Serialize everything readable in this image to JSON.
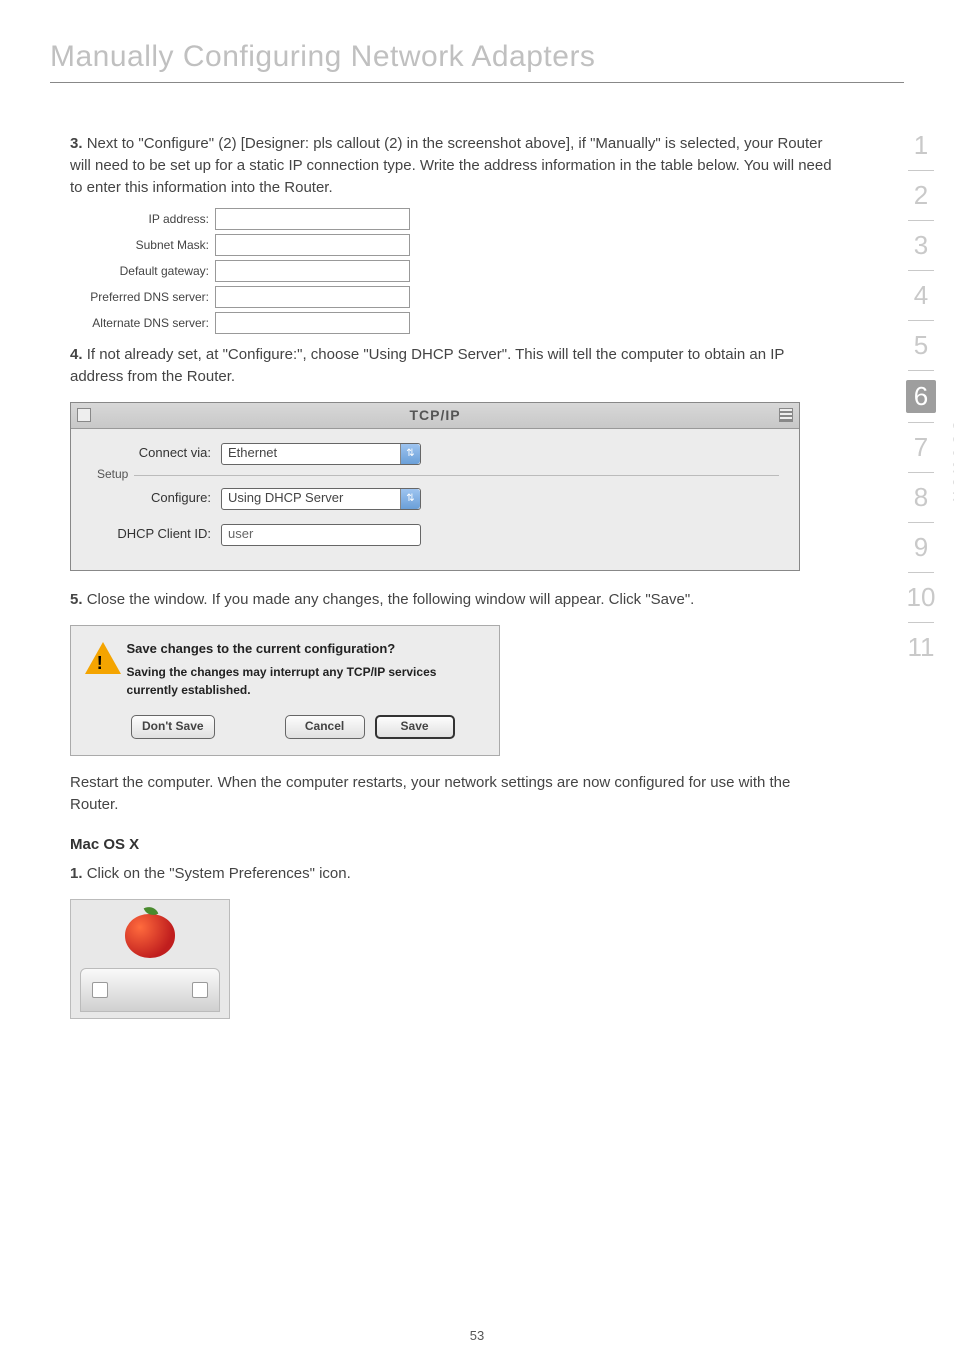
{
  "title": "Manually Configuring Network Adapters",
  "steps": {
    "s3": {
      "num": "3.",
      "text": "Next to \"Configure\" (2) [Designer: pls callout (2) in the screenshot above], if \"Manually\" is selected, your Router will need to be set up for a static IP connection type. Write the address information in the table below. You will need to enter this information into the Router."
    },
    "s4": {
      "num": "4.",
      "text": "If not already set, at \"Configure:\", choose \"Using DHCP Server\". This will tell the computer to obtain an IP address from the Router."
    },
    "s5": {
      "num": "5.",
      "text": "Close the window. If you made any changes, the following window will appear. Click \"Save\"."
    },
    "restart": "Restart the computer. When the computer restarts, your network settings are now configured for use with the Router."
  },
  "ipform": {
    "labels": {
      "ip": "IP address:",
      "subnet": "Subnet Mask:",
      "gateway": "Default gateway:",
      "pdns": "Preferred DNS server:",
      "adns": "Alternate DNS server:"
    }
  },
  "tcpip": {
    "title": "TCP/IP",
    "connect_via_label": "Connect via:",
    "connect_via_value": "Ethernet",
    "setup_legend": "Setup",
    "configure_label": "Configure:",
    "configure_value": "Using DHCP Server",
    "dhcp_client_label": "DHCP Client ID:",
    "dhcp_client_value": "user"
  },
  "dialog": {
    "heading": "Save changes to the current configuration?",
    "sub": "Saving the changes may interrupt any TCP/IP services currently established.",
    "dont_save": "Don't Save",
    "cancel": "Cancel",
    "save": "Save"
  },
  "macosx": {
    "heading": "Mac OS X",
    "step1_num": "1.",
    "step1_text": "Click on the \"System Preferences\" icon."
  },
  "side": {
    "numbers": [
      "1",
      "2",
      "3",
      "4",
      "5",
      "6",
      "7",
      "8",
      "9",
      "10",
      "11"
    ],
    "active_index": 5,
    "section_label": "section"
  },
  "page_number": "53"
}
